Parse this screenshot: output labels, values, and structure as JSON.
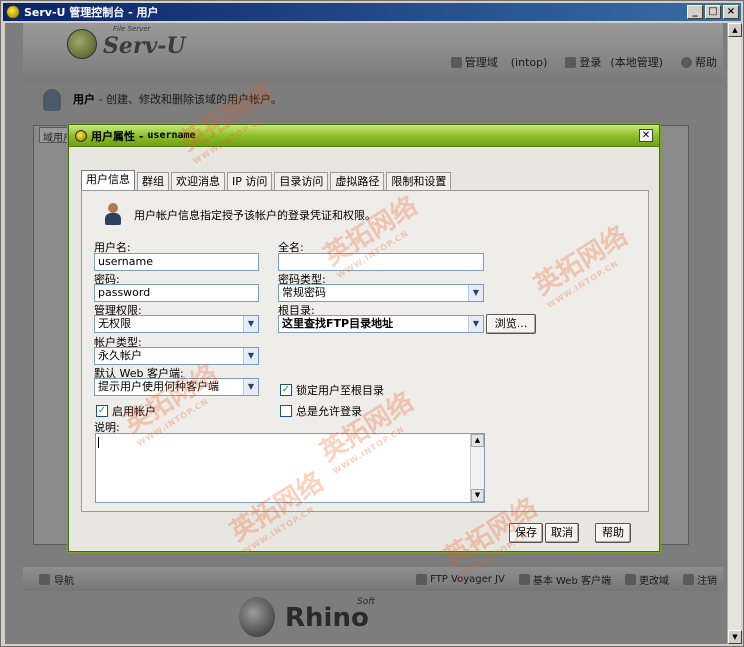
{
  "window": {
    "title": "Serv-U 管理控制台 - 用户",
    "buttons": [
      "_",
      "□",
      "×"
    ]
  },
  "app": {
    "logo_text": "Serv-U",
    "logo_sup": "File Server",
    "header_links": {
      "domain_label": "管理域",
      "domain_value": "(intop)",
      "login_label": "登录",
      "login_value": "(本地管理)",
      "help": "帮助"
    },
    "users_title": "用户",
    "users_desc": "- 创建、修改和删除该域的用户帐户。",
    "bg_tab": "域用户",
    "bottom": {
      "nav": "导航",
      "ftp_voyager": "FTP Voyager JV",
      "web_client": "基本 Web 客户端",
      "change_domain": "更改域",
      "logout": "注销"
    },
    "footer_logo": "Rhino",
    "footer_sup": "Soft"
  },
  "dialog": {
    "title": "用户属性 -",
    "title_user": "username",
    "tabs": [
      "用户信息",
      "群组",
      "欢迎消息",
      "IP 访问",
      "目录访问",
      "虚拟路径",
      "限制和设置"
    ],
    "description": "用户帐户信息指定授予该帐户的登录凭证和权限。",
    "fields": {
      "username_label": "用户名:",
      "username_value": "username",
      "fullname_label": "全名:",
      "fullname_value": "",
      "password_label": "密码:",
      "password_value": "password",
      "password_type_label": "密码类型:",
      "password_type_value": "常规密码",
      "admin_label": "管理权限:",
      "admin_value": "无权限",
      "root_label": "根目录:",
      "root_value": "这里查找FTP目录地址",
      "browse": "浏览...",
      "account_type_label": "帐户类型:",
      "account_type_value": "永久帐户",
      "web_client_label": "默认 Web 客户端:",
      "web_client_value": "提示用户使用何种客户端",
      "lock_root": "锁定用户至根目录",
      "enable_account": "启用帐户",
      "always_allow": "总是允许登录",
      "notes_label": "说明:"
    },
    "checks": {
      "lock_root": true,
      "enable_account": true,
      "always_allow": false
    },
    "buttons": {
      "save": "保存",
      "cancel": "取消",
      "help": "帮助"
    }
  },
  "watermark": {
    "text": "英拓网络",
    "sub": "WWW.INTOP.CN"
  },
  "colors": {
    "dialog_title_green": "#8fc02a",
    "titlebar_blue": "#0a246a",
    "watermark_orange": "#f05a1e"
  }
}
